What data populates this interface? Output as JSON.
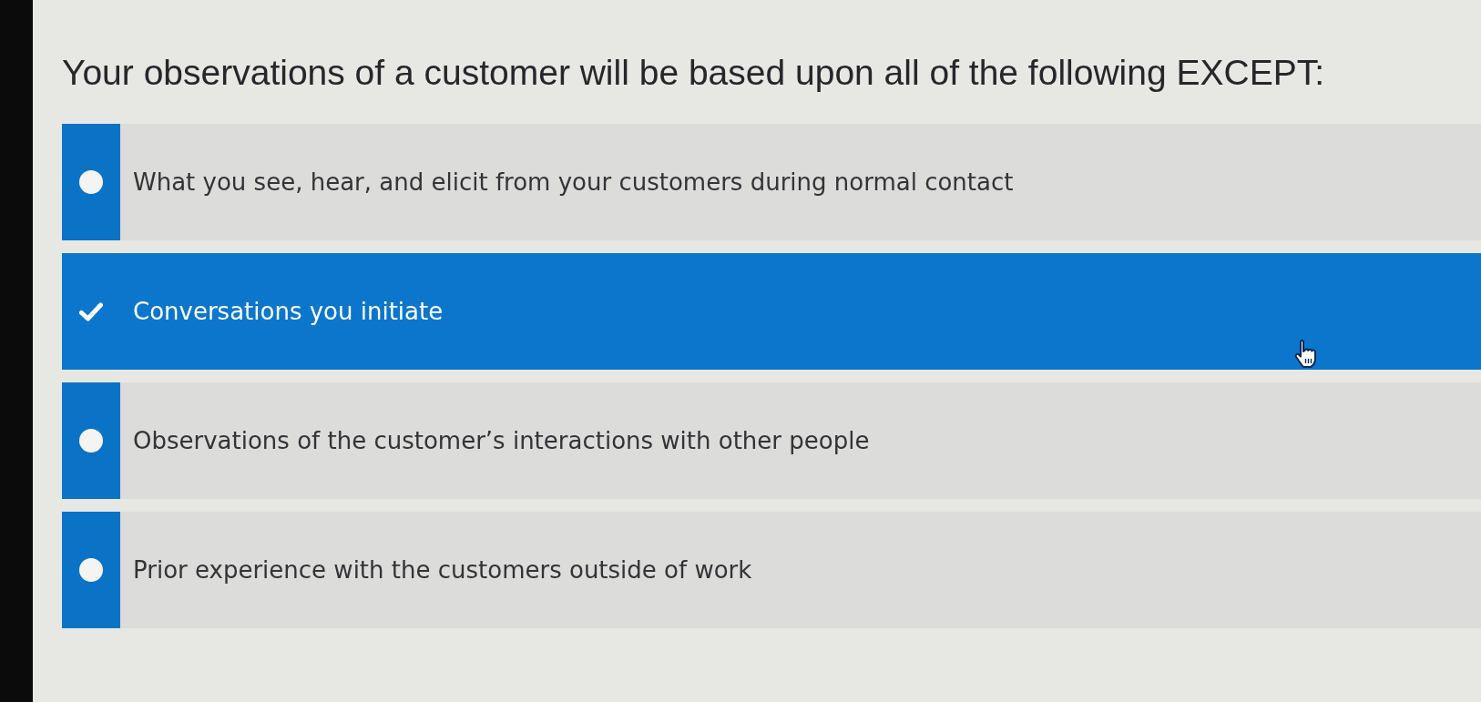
{
  "question": {
    "text": "Your observations of a customer will be based upon all of the following EXCEPT:"
  },
  "options": [
    {
      "label": "What you see, hear, and elicit from your customers during normal contact",
      "selected": false
    },
    {
      "label": "Conversations you initiate",
      "selected": true
    },
    {
      "label": "Observations of the customer’s interactions with other people",
      "selected": false
    },
    {
      "label": "Prior experience with the customers outside of work",
      "selected": false
    }
  ]
}
